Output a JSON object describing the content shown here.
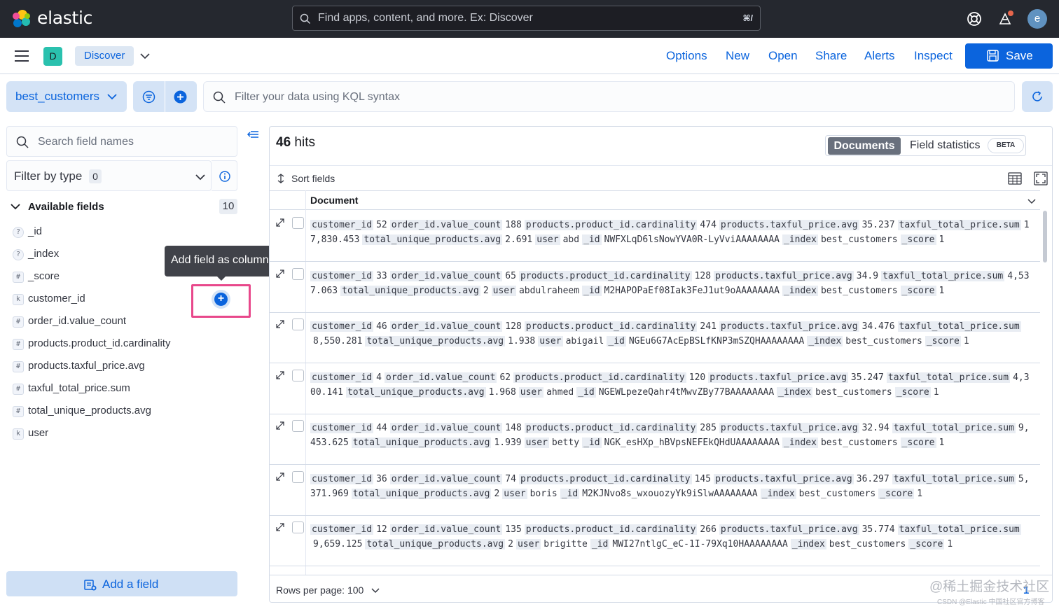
{
  "header": {
    "brand": "elastic",
    "search_placeholder": "Find apps, content, and more. Ex: Discover",
    "search_shortcut": "⌘/",
    "avatar_initial": "e"
  },
  "appbar": {
    "app_badge": "D",
    "breadcrumb": "Discover",
    "links": [
      "Options",
      "New",
      "Open",
      "Share",
      "Alerts",
      "Inspect"
    ],
    "save_label": "Save"
  },
  "querybar": {
    "data_view": "best_customers",
    "kql_placeholder": "Filter your data using KQL syntax"
  },
  "sidebar": {
    "search_placeholder": "Search field names",
    "filter_label": "Filter by type",
    "filter_count": "0",
    "available_label": "Available fields",
    "available_count": "10",
    "fields": [
      {
        "type": "?",
        "name": "_id"
      },
      {
        "type": "?",
        "name": "_index"
      },
      {
        "type": "#",
        "name": "_score"
      },
      {
        "type": "k",
        "name": "customer_id"
      },
      {
        "type": "#",
        "name": "order_id.value_count"
      },
      {
        "type": "#",
        "name": "products.product_id.cardinality"
      },
      {
        "type": "#",
        "name": "products.taxful_price.avg"
      },
      {
        "type": "#",
        "name": "taxful_total_price.sum"
      },
      {
        "type": "#",
        "name": "total_unique_products.avg"
      },
      {
        "type": "k",
        "name": "user"
      }
    ],
    "tooltip": "Add field as column",
    "add_field_label": "Add a field"
  },
  "main": {
    "hits_count": "46",
    "hits_label": " hits",
    "tab_documents": "Documents",
    "tab_field_stats": "Field statistics",
    "beta_badge": "BETA",
    "sort_label": "Sort fields",
    "column_header": "Document",
    "rows_per_page": "Rows per page: 100",
    "page_number": "1",
    "rows": [
      {
        "customer_id": "52",
        "order_id.value_count": "188",
        "products.product_id.cardinality": "474",
        "products.taxful_price.avg": "35.237",
        "taxful_total_price.sum": "17,830.453",
        "total_unique_products.avg": "2.691",
        "user": "abd",
        "_id": "NWFXLqD6lsNowYVA0R-LyVviAAAAAAAA",
        "_index": "best_customers",
        "_score": "1"
      },
      {
        "customer_id": "33",
        "order_id.value_count": "65",
        "products.product_id.cardinality": "128",
        "products.taxful_price.avg": "34.9",
        "taxful_total_price.sum": "4,537.063",
        "total_unique_products.avg": "2",
        "user": "abdulraheem",
        "_id": "M2HAPOPaEf08Iak3FeJ1ut9oAAAAAAAA",
        "_index": "best_customers",
        "_score": "1"
      },
      {
        "customer_id": "46",
        "order_id.value_count": "128",
        "products.product_id.cardinality": "241",
        "products.taxful_price.avg": "34.476",
        "taxful_total_price.sum": "8,550.281",
        "total_unique_products.avg": "1.938",
        "user": "abigail",
        "_id": "NGEu6G7AcEpBSLfKNP3mSZQHAAAAAAAA",
        "_index": "best_customers",
        "_score": "1"
      },
      {
        "customer_id": "4",
        "order_id.value_count": "62",
        "products.product_id.cardinality": "120",
        "products.taxful_price.avg": "35.247",
        "taxful_total_price.sum": "4,300.141",
        "total_unique_products.avg": "1.968",
        "user": "ahmed",
        "_id": "NGEWLpezeQahr4tMwvZBy77BAAAAAAAA",
        "_index": "best_customers",
        "_score": "1"
      },
      {
        "customer_id": "44",
        "order_id.value_count": "148",
        "products.product_id.cardinality": "285",
        "products.taxful_price.avg": "32.94",
        "taxful_total_price.sum": "9,453.625",
        "total_unique_products.avg": "1.939",
        "user": "betty",
        "_id": "NGK_esHXp_hBVpsNEFEkQHdUAAAAAAAA",
        "_index": "best_customers",
        "_score": "1"
      },
      {
        "customer_id": "36",
        "order_id.value_count": "74",
        "products.product_id.cardinality": "145",
        "products.taxful_price.avg": "36.297",
        "taxful_total_price.sum": "5,371.969",
        "total_unique_products.avg": "2",
        "user": "boris",
        "_id": "M2KJNvo8s_wxouozyYk9iSlwAAAAAAAA",
        "_index": "best_customers",
        "_score": "1"
      },
      {
        "customer_id": "12",
        "order_id.value_count": "135",
        "products.product_id.cardinality": "266",
        "products.taxful_price.avg": "35.774",
        "taxful_total_price.sum": "9,659.125",
        "total_unique_products.avg": "2",
        "user": "brigitte",
        "_id": "MWI27ntlgC_eC-1I-79Xq10HAAAAAAAA",
        "_index": "best_customers",
        "_score": "1"
      }
    ]
  },
  "watermark": "@稀土掘金技术社区",
  "watermark_small": "CSDN @Elastic 中国社区官方博客",
  "colors": {
    "accent": "#0b64dd",
    "header_bg": "#25282f",
    "highlight": "#e8488b"
  }
}
